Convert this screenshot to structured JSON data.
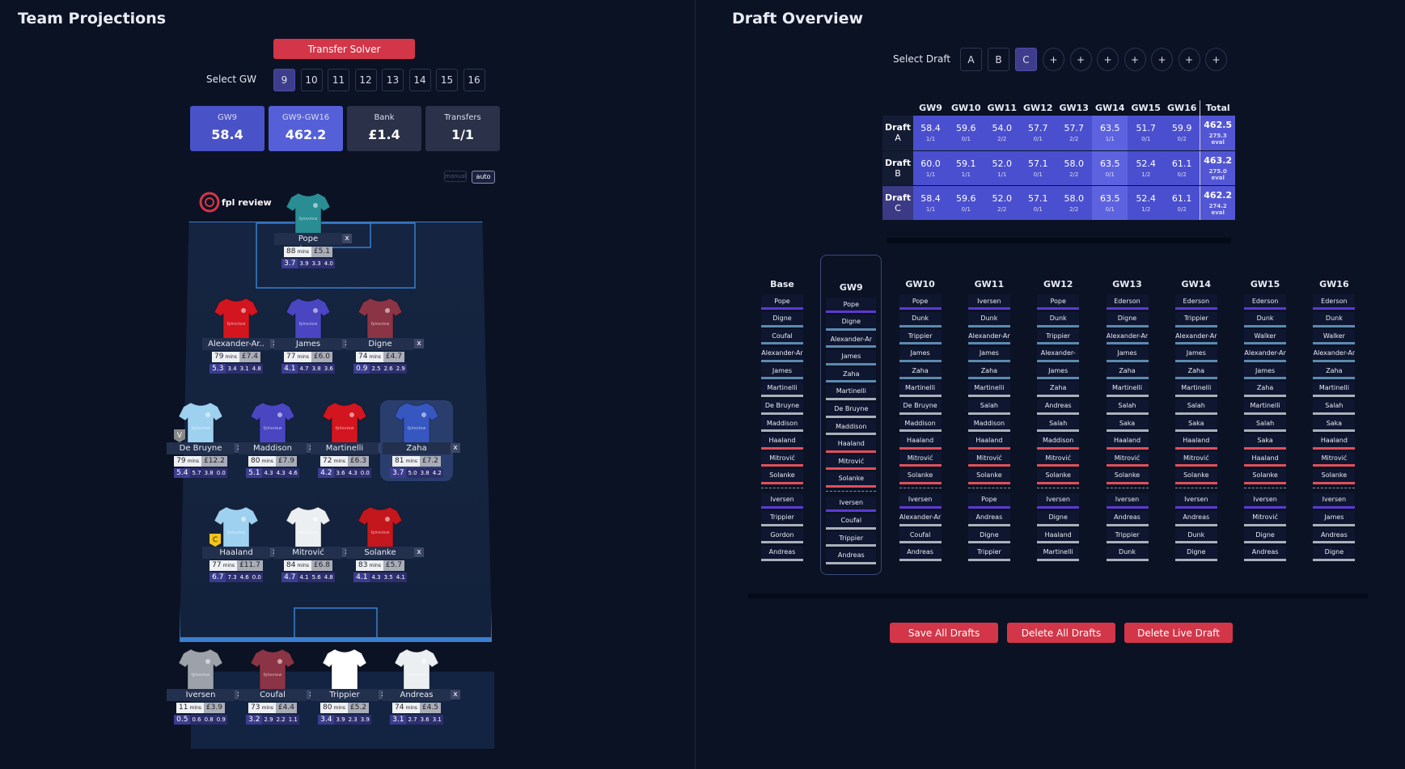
{
  "left": {
    "title": "Team Projections",
    "transfer_solver": "Transfer Solver",
    "select_gw": "Select GW",
    "gws": [
      "9",
      "10",
      "11",
      "12",
      "13",
      "14",
      "15",
      "16"
    ],
    "stats": [
      {
        "label": "GW9",
        "value": "58.4"
      },
      {
        "label": "GW9-GW16",
        "value": "462.2"
      },
      {
        "label": "Bank",
        "value": "£1.4"
      },
      {
        "label": "Transfers",
        "value": "1/1"
      }
    ],
    "toggle": [
      "manual",
      "auto"
    ],
    "logo": "fpl review",
    "shirt_text": "fplreview",
    "players": [
      {
        "name": "Pope",
        "mins": "88",
        "price": "£5.1",
        "xp": "3.7",
        "s": [
          "3.9",
          "3.3",
          "4.0"
        ],
        "color": "#2a8d94"
      },
      {
        "name": "Alexander-Ar..",
        "mins": "79",
        "price": "£7.4",
        "xp": "5.3",
        "s": [
          "3.4",
          "3.1",
          "4.8"
        ],
        "color": "#d3151f"
      },
      {
        "name": "James",
        "mins": "77",
        "price": "£6.0",
        "xp": "4.1",
        "s": [
          "4.7",
          "3.8",
          "3.6"
        ],
        "color": "#4a46c2"
      },
      {
        "name": "Digne",
        "mins": "74",
        "price": "£4.7",
        "xp": "0.9",
        "s": [
          "2.5",
          "2.6",
          "2.9"
        ],
        "color": "#8b3445"
      },
      {
        "name": "De Bruyne",
        "mins": "79",
        "price": "£12.2",
        "xp": "5.4",
        "s": [
          "5.7",
          "3.8",
          "0.0"
        ],
        "color": "#9ed1f0"
      },
      {
        "name": "Maddison",
        "mins": "80",
        "price": "£7.9",
        "xp": "5.1",
        "s": [
          "4.3",
          "4.3",
          "4.6"
        ],
        "color": "#4a46c2"
      },
      {
        "name": "Martinelli",
        "mins": "72",
        "price": "£6.3",
        "xp": "4.2",
        "s": [
          "3.6",
          "4.3",
          "0.0"
        ],
        "color": "#d3151f"
      },
      {
        "name": "Zaha",
        "mins": "81",
        "price": "£7.2",
        "xp": "3.7",
        "s": [
          "5.0",
          "3.8",
          "4.2"
        ],
        "color": "#3757c0"
      },
      {
        "name": "Haaland",
        "mins": "77",
        "price": "£11.7",
        "xp": "6.7",
        "s": [
          "7.3",
          "4.6",
          "0.0"
        ],
        "color": "#9ed1f0"
      },
      {
        "name": "Mitrović",
        "mins": "84",
        "price": "£6.8",
        "xp": "4.7",
        "s": [
          "4.1",
          "5.6",
          "4.8"
        ],
        "color": "#eceff2"
      },
      {
        "name": "Solanke",
        "mins": "83",
        "price": "£5.7",
        "xp": "4.1",
        "s": [
          "4.3",
          "3.5",
          "4.1"
        ],
        "color": "#c3171d"
      },
      {
        "name": "Iversen",
        "mins": "11",
        "price": "£3.9",
        "xp": "0.5",
        "s": [
          "0.6",
          "0.8",
          "0.9"
        ],
        "color": "#9da2aa"
      },
      {
        "name": "Coufal",
        "mins": "73",
        "price": "£4.4",
        "xp": "3.2",
        "s": [
          "2.9",
          "2.2",
          "1.1"
        ],
        "color": "#8b3445"
      },
      {
        "name": "Trippier",
        "mins": "80",
        "price": "£5.2",
        "xp": "3.4",
        "s": [
          "3.9",
          "2.3",
          "3.9"
        ],
        "color": "#ffffff"
      },
      {
        "name": "Andreas",
        "mins": "74",
        "price": "£4.5",
        "xp": "3.1",
        "s": [
          "2.7",
          "3.6",
          "3.1"
        ],
        "color": "#eceff2"
      }
    ],
    "mins_unit": "mins",
    "captain": "C",
    "vice": "V",
    "remove": "x"
  },
  "right": {
    "title": "Draft Overview",
    "select_draft": "Select Draft",
    "drafts": [
      "A",
      "B",
      "C"
    ],
    "plus": "+",
    "table_head": [
      "GW9",
      "GW10",
      "GW11",
      "GW12",
      "GW13",
      "GW14",
      "GW15",
      "GW16",
      "Total"
    ],
    "draft_label": "Draft",
    "rows": [
      {
        "id": "A",
        "vals": [
          "58.4",
          "59.6",
          "54.0",
          "57.7",
          "57.7",
          "63.5",
          "51.7",
          "59.9"
        ],
        "tr": [
          "1/1",
          "0/1",
          "2/2",
          "0/1",
          "2/2",
          "1/1",
          "0/1",
          "0/2"
        ],
        "total": "462.5",
        "eval": "275.3 eval"
      },
      {
        "id": "B",
        "vals": [
          "60.0",
          "59.1",
          "52.0",
          "57.1",
          "58.0",
          "63.5",
          "52.4",
          "61.1"
        ],
        "tr": [
          "1/1",
          "1/1",
          "1/1",
          "0/1",
          "2/2",
          "0/1",
          "1/2",
          "0/2"
        ],
        "total": "463.2",
        "eval": "275.0 eval"
      },
      {
        "id": "C",
        "vals": [
          "58.4",
          "59.6",
          "52.0",
          "57.1",
          "58.0",
          "63.5",
          "52.4",
          "61.1"
        ],
        "tr": [
          "1/1",
          "0/1",
          "2/2",
          "0/1",
          "2/2",
          "0/1",
          "1/2",
          "0/2"
        ],
        "total": "462.2",
        "eval": "274.2 eval"
      }
    ],
    "columns": [
      {
        "h": "Base",
        "p": [
          "Pope",
          "Digne",
          "Coufal",
          "Alexander-Ar",
          "James",
          "Martinelli",
          "De Bruyne",
          "Maddison",
          "Haaland",
          "Mitrović",
          "Solanke"
        ],
        "b": [
          "Iversen",
          "Trippier",
          "Gordon",
          "Andreas"
        ]
      },
      {
        "h": "GW9",
        "p": [
          "Pope",
          "Digne",
          "Alexander-Ar",
          "James",
          "Zaha",
          "Martinelli",
          "De Bruyne",
          "Maddison",
          "Haaland",
          "Mitrović",
          "Solanke"
        ],
        "b": [
          "Iversen",
          "Coufal",
          "Trippier",
          "Andreas"
        ]
      },
      {
        "h": "GW10",
        "p": [
          "Pope",
          "Dunk",
          "Trippier",
          "James",
          "Zaha",
          "Martinelli",
          "De Bruyne",
          "Maddison",
          "Haaland",
          "Mitrović",
          "Solanke"
        ],
        "b": [
          "Iversen",
          "Alexander-Ar",
          "Coufal",
          "Andreas"
        ]
      },
      {
        "h": "GW11",
        "p": [
          "Iversen",
          "Dunk",
          "Alexander-Ar",
          "James",
          "Zaha",
          "Martinelli",
          "Salah",
          "Maddison",
          "Haaland",
          "Mitrović",
          "Solanke"
        ],
        "b": [
          "Pope",
          "Andreas",
          "Digne",
          "Trippier"
        ]
      },
      {
        "h": "GW12",
        "p": [
          "Pope",
          "Dunk",
          "Trippier",
          "Alexander-",
          "James",
          "Zaha",
          "Andreas",
          "Salah",
          "Maddison",
          "Mitrović",
          "Solanke"
        ],
        "b": [
          "Iversen",
          "Digne",
          "Haaland",
          "Martinelli"
        ]
      },
      {
        "h": "GW13",
        "p": [
          "Ederson",
          "Digne",
          "Alexander-Ar",
          "James",
          "Zaha",
          "Martinelli",
          "Salah",
          "Saka",
          "Haaland",
          "Mitrović",
          "Solanke"
        ],
        "b": [
          "Iversen",
          "Andreas",
          "Trippier",
          "Dunk"
        ]
      },
      {
        "h": "GW14",
        "p": [
          "Ederson",
          "Trippier",
          "Alexander-Ar",
          "James",
          "Zaha",
          "Martinelli",
          "Salah",
          "Saka",
          "Haaland",
          "Mitrović",
          "Solanke"
        ],
        "b": [
          "Iversen",
          "Andreas",
          "Dunk",
          "Digne"
        ]
      },
      {
        "h": "GW15",
        "p": [
          "Ederson",
          "Dunk",
          "Walker",
          "Alexander-Ar",
          "James",
          "Zaha",
          "Martinelli",
          "Salah",
          "Saka",
          "Haaland",
          "Solanke"
        ],
        "b": [
          "Iversen",
          "Mitrović",
          "Digne",
          "Andreas"
        ]
      },
      {
        "h": "GW16",
        "p": [
          "Ederson",
          "Dunk",
          "Walker",
          "Alexander-Ar",
          "Zaha",
          "Martinelli",
          "Salah",
          "Saka",
          "Haaland",
          "Mitrović",
          "Solanke"
        ],
        "b": [
          "Iversen",
          "James",
          "Andreas",
          "Digne"
        ]
      }
    ],
    "buttons": [
      "Save All Drafts",
      "Delete All Drafts",
      "Delete Live Draft"
    ]
  }
}
